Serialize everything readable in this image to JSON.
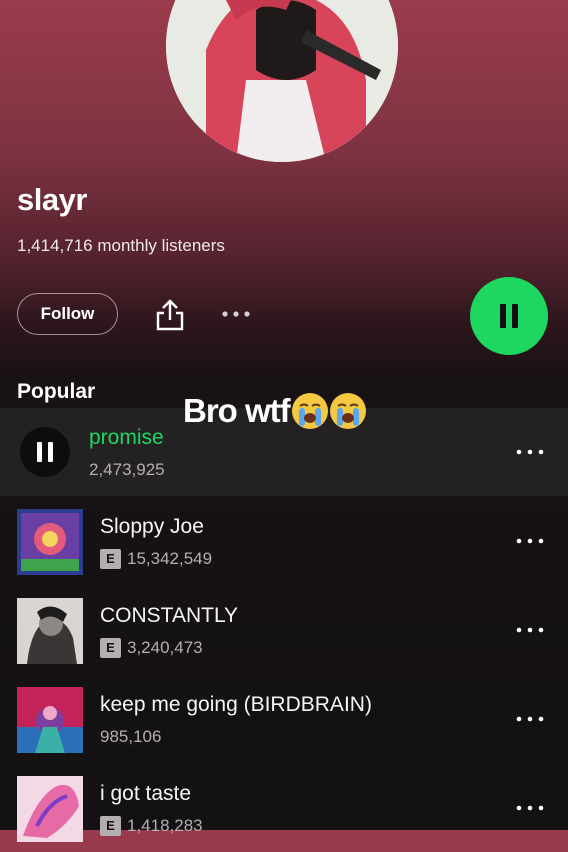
{
  "artist": {
    "name": "slayr",
    "monthly_listeners": "1,414,716 monthly listeners"
  },
  "actions": {
    "follow_label": "Follow"
  },
  "overlay_caption": "Bro wtf",
  "popular": {
    "title": "Popular",
    "tracks": [
      {
        "title": "promise",
        "plays": "2,473,925",
        "explicit": false,
        "playing": true
      },
      {
        "title": "Sloppy Joe",
        "plays": "15,342,549",
        "explicit": true,
        "playing": false
      },
      {
        "title": "CONSTANTLY",
        "plays": "3,240,473",
        "explicit": true,
        "playing": false
      },
      {
        "title": "keep me going (BIRDBRAIN)",
        "plays": "985,106",
        "explicit": false,
        "playing": false
      },
      {
        "title": "i got taste",
        "plays": "1,418,283",
        "explicit": true,
        "playing": false
      }
    ]
  },
  "explicit_label": "E",
  "colors": {
    "accent": "#1ed760",
    "header_top": "#9a3b4c",
    "background": "#131113"
  }
}
